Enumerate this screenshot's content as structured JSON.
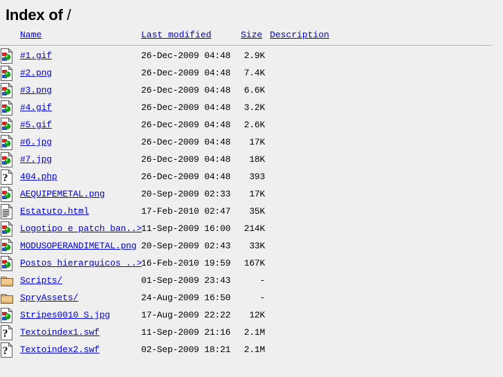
{
  "header": {
    "title_prefix": "Index of",
    "title_path": "/"
  },
  "columns": {
    "icon": "",
    "name": "Name",
    "last_modified": "Last modified",
    "size": "Size",
    "description": "Description"
  },
  "rows": [
    {
      "icon": "image-file-icon",
      "name": "#1.gif",
      "last_modified": "26-Dec-2009 04:48",
      "size": "2.9K",
      "description": ""
    },
    {
      "icon": "image-file-icon",
      "name": "#2.png",
      "last_modified": "26-Dec-2009 04:48",
      "size": "7.4K",
      "description": ""
    },
    {
      "icon": "image-file-icon",
      "name": "#3.png",
      "last_modified": "26-Dec-2009 04:48",
      "size": "6.6K",
      "description": ""
    },
    {
      "icon": "image-file-icon",
      "name": "#4.gif",
      "last_modified": "26-Dec-2009 04:48",
      "size": "3.2K",
      "description": ""
    },
    {
      "icon": "image-file-icon",
      "name": "#5.gif",
      "last_modified": "26-Dec-2009 04:48",
      "size": "2.6K",
      "description": ""
    },
    {
      "icon": "image-file-icon",
      "name": "#6.jpg",
      "last_modified": "26-Dec-2009 04:48",
      "size": "17K",
      "description": ""
    },
    {
      "icon": "image-file-icon",
      "name": "#7.jpg",
      "last_modified": "26-Dec-2009 04:48",
      "size": "18K",
      "description": ""
    },
    {
      "icon": "unknown-file-icon",
      "name": "404.php",
      "last_modified": "26-Dec-2009 04:48",
      "size": "393",
      "description": ""
    },
    {
      "icon": "image-file-icon",
      "name": "AEQUIPEMETAL.png",
      "last_modified": "20-Sep-2009 02:33",
      "size": "17K",
      "description": ""
    },
    {
      "icon": "text-file-icon",
      "name": "Estatuto.html",
      "last_modified": "17-Feb-2010 02:47",
      "size": "35K",
      "description": ""
    },
    {
      "icon": "image-file-icon",
      "name": "Logotipo e patch ban..>",
      "last_modified": "11-Sep-2009 16:00",
      "size": "214K",
      "description": ""
    },
    {
      "icon": "image-file-icon",
      "name": "MODUSOPERANDIMETAL.png",
      "last_modified": "20-Sep-2009 02:43",
      "size": "33K",
      "description": ""
    },
    {
      "icon": "image-file-icon",
      "name": "Postos hierarquicos ..>",
      "last_modified": "16-Feb-2010 19:59",
      "size": "167K",
      "description": ""
    },
    {
      "icon": "folder-icon",
      "name": "Scripts/",
      "last_modified": "01-Sep-2009 23:43",
      "size": "-",
      "description": ""
    },
    {
      "icon": "folder-icon",
      "name": "SpryAssets/",
      "last_modified": "24-Aug-2009 16:50",
      "size": "-",
      "description": ""
    },
    {
      "icon": "image-file-icon",
      "name": "Stripes0010 S.jpg",
      "last_modified": "17-Aug-2009 22:22",
      "size": "12K",
      "description": ""
    },
    {
      "icon": "unknown-file-icon",
      "name": "Textoindex1.swf",
      "last_modified": "11-Sep-2009 21:16",
      "size": "2.1M",
      "description": ""
    },
    {
      "icon": "unknown-file-icon",
      "name": "Textoindex2.swf",
      "last_modified": "02-Sep-2009 18:21",
      "size": "2.1M",
      "description": ""
    }
  ],
  "colors": {
    "background": "#efefef",
    "link": "#0000dd",
    "text": "#000000",
    "rule": "#aaaaaa",
    "folder": "#f3c98b"
  }
}
